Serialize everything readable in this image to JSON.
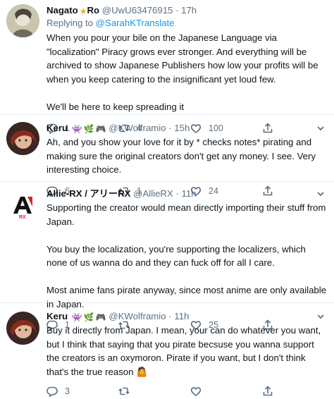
{
  "tweets": [
    {
      "name": "Nagato",
      "name_suffix": "Ro",
      "handle": "@UwU63476915",
      "time": "17h",
      "reply_prefix": "Replying to ",
      "reply_to": "@SarahKTranslate",
      "text": "When you pour your bile on the Japanese Language via \"localization\" Piracy grows ever stronger. And everything will be archived to show Japanese Publishers how low your profits will be when you keep catering to the insignificant yet loud few.\n\nWe'll be here to keep spreading it",
      "replies": "1",
      "retweets": "4",
      "likes": "100"
    },
    {
      "name": "Keru",
      "handle": "@KWolframio",
      "time": "15h",
      "text": "Ah, and you show your love for it by * checks notes* pirating and making sure the original creators don't get any money. I see. Very interesting choice.",
      "replies": "6",
      "retweets": "1",
      "likes": "24"
    },
    {
      "name": "Allie-RX / アリーRX",
      "handle": "@AllieRX",
      "time": "11h",
      "avatar_text": "RX",
      "text": "Supporting the creator would mean directly importing their stuff from Japan.\n\nYou buy the localization, you're supporting the localizers, which none of us wanna do and they can fuck off for all I care.\n\nMost anime fans pirate anyway, since most anime are only available in Japan.",
      "replies": "1",
      "retweets": "",
      "likes": "25"
    },
    {
      "name": "Keru",
      "handle": "@KWolframio",
      "time": "11h",
      "text": "Buy it directly from Japan. I mean, your can do whatever you want, but I think that saying that you pirate becsuse you wanna support the creators is an oxymoron. Pirate if you want, but I don't think that's the true reason 🤷",
      "replies": "3",
      "retweets": "",
      "likes": ""
    }
  ],
  "separator": "·",
  "colors": {
    "link": "#1b95e0",
    "muted": "#5b7083",
    "text": "#0f1419",
    "border": "#e6ecf0"
  },
  "icons": [
    "reply-icon",
    "retweet-icon",
    "like-icon",
    "share-icon",
    "more-caret-icon"
  ]
}
